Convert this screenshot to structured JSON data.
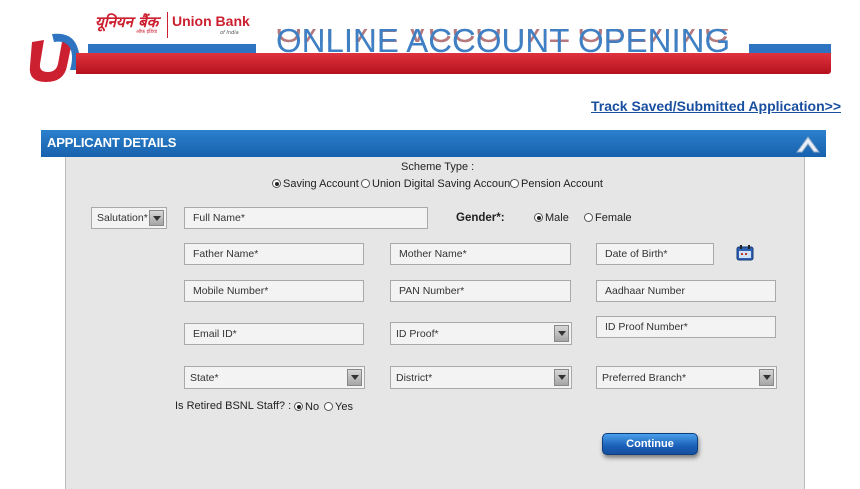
{
  "header": {
    "logo_hindi": "यूनियन बैंक",
    "logo_hindi_sub": "ऑफ़ इंडिया",
    "logo_english": "Union Bank",
    "logo_english_sub": "of India",
    "banner_title": "ONLINE ACCOUNT OPENING",
    "track_link": "Track Saved/Submitted Application>>"
  },
  "colors": {
    "brand_red": "#cc1f2f",
    "brand_blue": "#2e74c0",
    "panel_header": "#1f6fbf",
    "link": "#1a4fa0"
  },
  "panel": {
    "title": "APPLICANT DETAILS",
    "collapse_icon": "chevron-up-icon"
  },
  "scheme": {
    "label": "Scheme Type :",
    "options": [
      {
        "label": "Saving Account",
        "selected": true
      },
      {
        "label": "Union Digital Saving Account",
        "selected": false
      },
      {
        "label": "Pension Account",
        "selected": false
      }
    ]
  },
  "form": {
    "salutation": "Salutation*",
    "full_name": "Full Name*",
    "gender_label": "Gender*:",
    "gender_options": [
      {
        "label": "Male",
        "selected": true
      },
      {
        "label": "Female",
        "selected": false
      }
    ],
    "father_name": "Father Name*",
    "mother_name": "Mother Name*",
    "dob": "Date of Birth*",
    "calendar_icon": "calendar-icon",
    "mobile": "Mobile Number*",
    "pan": "PAN Number*",
    "aadhaar": "Aadhaar Number",
    "email": "Email ID*",
    "id_proof": "ID Proof*",
    "id_proof_number": "ID Proof Number*",
    "state": "State*",
    "district": "District*",
    "branch": "Preferred Branch*",
    "bsnl_label": "Is Retired BSNL Staff? :",
    "bsnl_options": [
      {
        "label": "No",
        "selected": true
      },
      {
        "label": "Yes",
        "selected": false
      }
    ],
    "continue": "Continue"
  }
}
